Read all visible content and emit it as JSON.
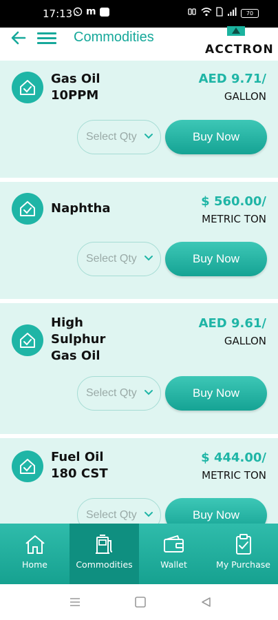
{
  "status_bar": {
    "time": "17:13",
    "left_icons": [
      "whatsapp-icon",
      "m",
      "notification-badge-icon"
    ],
    "badge_text": "",
    "battery": "70"
  },
  "header": {
    "title": "Commodities",
    "logo_text": "ACCTRON"
  },
  "products": [
    {
      "name": "Gas Oil\n10PPM",
      "price": "AED 9.71/",
      "unit": "GALLON",
      "qty_placeholder": "Select Qty",
      "buy_label": "Buy Now"
    },
    {
      "name": "Naphtha",
      "price": "$ 560.00/",
      "unit": "METRIC TON",
      "qty_placeholder": "Select Qty",
      "buy_label": "Buy Now"
    },
    {
      "name": "High\nSulphur\nGas Oil",
      "price": "AED 9.61/",
      "unit": "GALLON",
      "qty_placeholder": "Select Qty",
      "buy_label": "Buy Now"
    },
    {
      "name": "Fuel Oil\n180 CST",
      "price": "$ 444.00/",
      "unit": "METRIC TON",
      "qty_placeholder": "Select Qty",
      "buy_label": "Buy Now"
    }
  ],
  "bottom_nav": [
    {
      "label": "Home",
      "icon": "home-icon",
      "active": false
    },
    {
      "label": "Commodities",
      "icon": "fuel-pump-icon",
      "active": true
    },
    {
      "label": "Wallet",
      "icon": "wallet-icon",
      "active": false
    },
    {
      "label": "My Purchase",
      "icon": "clipboard-check-icon",
      "active": false
    }
  ],
  "colors": {
    "accent": "#16a89a",
    "card_bg": "#dff5f1",
    "nav_bg": "#1fb0a0"
  }
}
